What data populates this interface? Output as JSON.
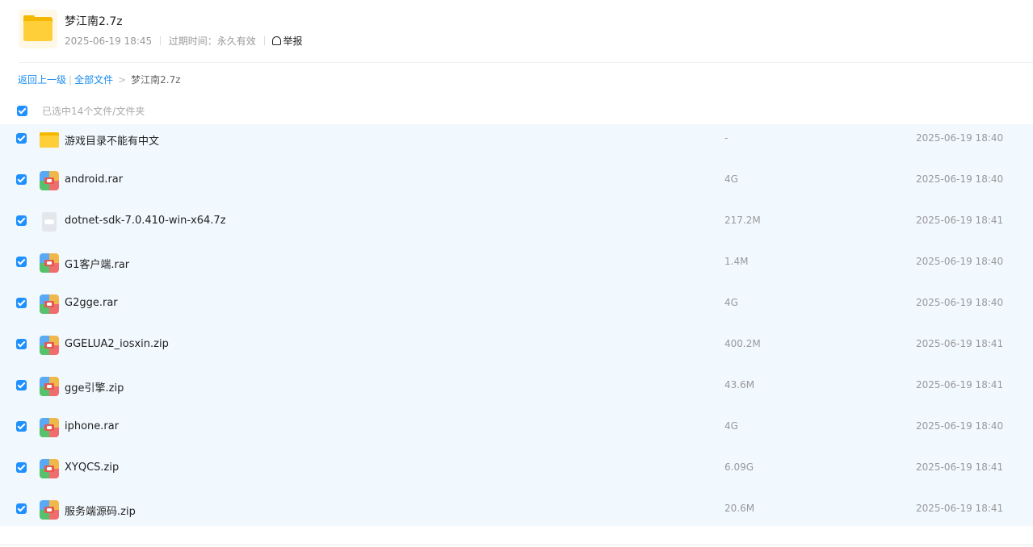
{
  "share": {
    "title": "梦江南2.7z",
    "date": "2025-06-19 18:45",
    "expire": "过期时间：永久有效",
    "report_label": "举报"
  },
  "breadcrumb": {
    "back": "返回上一级",
    "separator": "|",
    "all_files": "全部文件",
    "arrow": ">",
    "current": "梦江南2.7z"
  },
  "selection": {
    "text": "已选中14个文件/文件夹"
  },
  "files": [
    {
      "name": "游戏目录不能有中文",
      "size": "-",
      "date": "2025-06-19 18:40",
      "icon": "folder-icon"
    },
    {
      "name": "android.rar",
      "size": "4G",
      "date": "2025-06-19 18:40",
      "icon": "archive-icon"
    },
    {
      "name": "dotnet-sdk-7.0.410-win-x64.7z",
      "size": "217.2M",
      "date": "2025-06-19 18:41",
      "icon": "file-icon"
    },
    {
      "name": "G1客户端.rar",
      "size": "1.4M",
      "date": "2025-06-19 18:40",
      "icon": "archive-icon"
    },
    {
      "name": "G2gge.rar",
      "size": "4G",
      "date": "2025-06-19 18:40",
      "icon": "archive-icon"
    },
    {
      "name": "GGELUA2_iosxin.zip",
      "size": "400.2M",
      "date": "2025-06-19 18:41",
      "icon": "archive-icon"
    },
    {
      "name": "gge引擎.zip",
      "size": "43.6M",
      "date": "2025-06-19 18:41",
      "icon": "archive-icon"
    },
    {
      "name": "iphone.rar",
      "size": "4G",
      "date": "2025-06-19 18:40",
      "icon": "archive-icon"
    },
    {
      "name": "XYQCS.zip",
      "size": "6.09G",
      "date": "2025-06-19 18:41",
      "icon": "archive-icon"
    },
    {
      "name": "服务端源码.zip",
      "size": "20.6M",
      "date": "2025-06-19 18:41",
      "icon": "archive-icon"
    }
  ],
  "colors": {
    "accent": "#1e90ff",
    "list_bg": "#f1f8fe",
    "link": "#1a8cf0"
  }
}
